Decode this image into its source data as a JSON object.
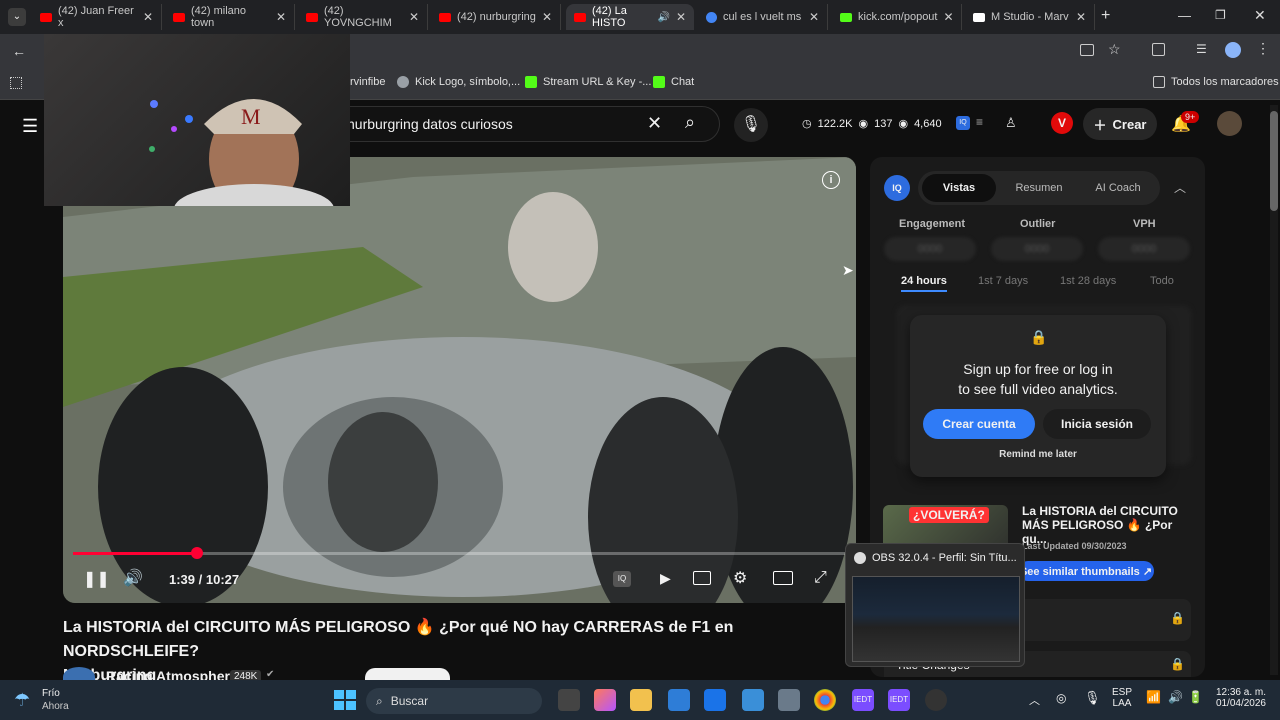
{
  "tabs": [
    {
      "title": "(42) Juan Freer x",
      "fav": "youtube-icon"
    },
    {
      "title": "(42) milano town",
      "fav": "youtube-icon"
    },
    {
      "title": "(42) YOVNGCHIM",
      "fav": "youtube-icon"
    },
    {
      "title": "(42) nurburgring",
      "fav": "youtube-icon"
    },
    {
      "title": "(42) La HISTO",
      "fav": "youtube-icon"
    },
    {
      "title": "cul es l vuelt ms",
      "fav": "google-icon"
    },
    {
      "title": "kick.com/popout",
      "fav": "kick-icon"
    },
    {
      "title": "M Studio - Marv",
      "fav": "m-icon"
    }
  ],
  "bookmarks": {
    "b1": "rvinfibe",
    "b2": "Kick Logo, símbolo,...",
    "b3": "Stream URL & Key -...",
    "b4": "Chat",
    "all": "Todos los marcadores"
  },
  "search": {
    "value": "nurburgring datos curiosos"
  },
  "stats": {
    "subs": "122.2K",
    "views": "137",
    "other": "4,640"
  },
  "header": {
    "create": "Crear",
    "notif": "9+"
  },
  "player": {
    "time": "1:39 / 10:27",
    "progress": 0.16
  },
  "video": {
    "title_line1": "La HISTORIA del CIRCUITO MÁS PELIGROSO 🔥 ¿Por qué NO hay CARRERAS de F1 en NORDSCHLEIFE?",
    "title_line2": "Nürburgring",
    "channel": "Racing Atmosphere",
    "subs_badge": "248K"
  },
  "panel": {
    "tabs": [
      "Vistas",
      "Resumen",
      "AI Coach"
    ],
    "metrics": [
      "Engagement",
      "Outlier",
      "VPH"
    ],
    "metric_values": [
      "0000",
      "0000",
      "0000"
    ],
    "ranges": [
      "24 hours",
      "1st 7 days",
      "1st 28 days",
      "Todo"
    ],
    "lock_text1": "Sign up for free or log in",
    "lock_text2": "to see full video analytics.",
    "create_btn": "Crear cuenta",
    "login_btn": "Inicia sesión",
    "remind": "Remind me later",
    "thumb_badge": "¿VOLVERÁ?",
    "rel_title": "La HISTORIA del CIRCUITO MÁS PELIGROSO 🔥 ¿Por qu...",
    "rel_updated": "Last Updated 09/30/2023",
    "rel_btn": "See similar thumbnails ↗",
    "changes": "Title Changes"
  },
  "obs": {
    "title": "OBS 32.0.4 - Perfil: Sin Títu..."
  },
  "taskbar": {
    "weather1": "Frío",
    "weather2": "Ahora",
    "search": "Buscar",
    "lang1": "ESP",
    "lang2": "LAA",
    "time": "12:36 a. m.",
    "date": "01/04/2026"
  }
}
